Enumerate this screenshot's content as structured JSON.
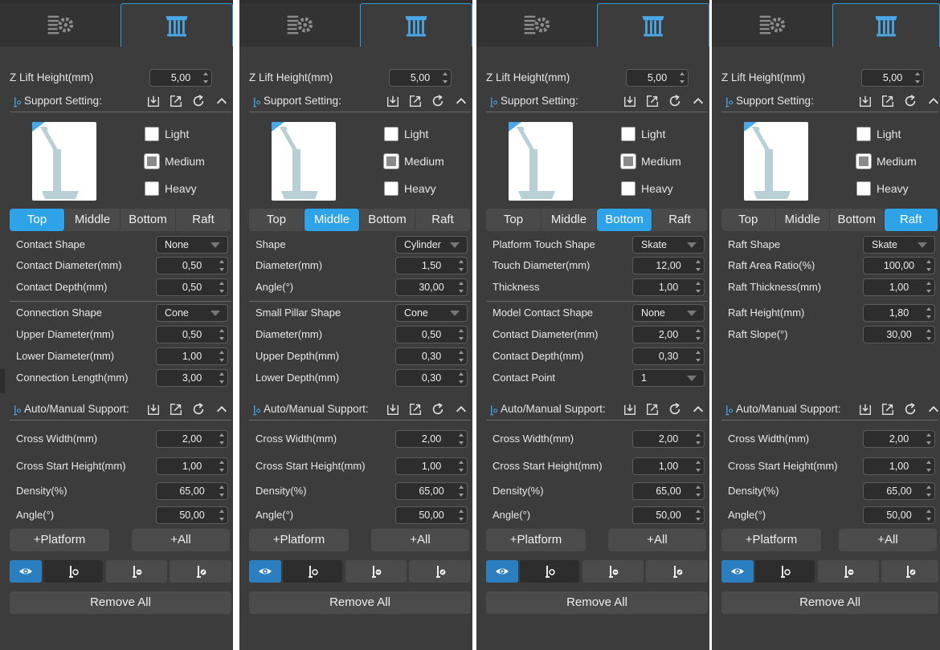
{
  "labels": {
    "z_lift": "Z Lift Height(mm)",
    "z_lift_value": "5,00",
    "support_setting": "Support Setting:",
    "auto_manual": "Auto/Manual Support:",
    "light": "Light",
    "medium": "Medium",
    "heavy": "Heavy",
    "tabs": [
      "Top",
      "Middle",
      "Bottom",
      "Raft"
    ],
    "platform": "+Platform",
    "all": "+All",
    "remove_all": "Remove All"
  },
  "auto": [
    {
      "label": "Cross Width(mm)",
      "value": "2,00"
    },
    {
      "label": "Cross Start Height(mm)",
      "value": "1,00"
    },
    {
      "label": "Density(%)",
      "value": "65,00"
    },
    {
      "label": "Angle(°)",
      "value": "50,00"
    }
  ],
  "panels": [
    {
      "active_tab": "Top",
      "rows": [
        {
          "label": "Contact Shape",
          "value": "None",
          "kind": "combo"
        },
        {
          "label": "Contact Diameter(mm)",
          "value": "0,50",
          "kind": "spin"
        },
        {
          "label": "Contact Depth(mm)",
          "value": "0,50",
          "kind": "spin"
        },
        {
          "label": "Connection Shape",
          "value": "Cone",
          "kind": "combo"
        },
        {
          "label": "Upper Diameter(mm)",
          "value": "0,50",
          "kind": "spin"
        },
        {
          "label": "Lower Diameter(mm)",
          "value": "1,00",
          "kind": "spin"
        },
        {
          "label": "Connection Length(mm)",
          "value": "3,00",
          "kind": "spin"
        }
      ]
    },
    {
      "active_tab": "Middle",
      "rows": [
        {
          "label": "Shape",
          "value": "Cylinder",
          "kind": "combo"
        },
        {
          "label": "Diameter(mm)",
          "value": "1,50",
          "kind": "spin"
        },
        {
          "label": "Angle(°)",
          "value": "30,00",
          "kind": "spin"
        },
        {
          "label": "Small Pillar Shape",
          "value": "Cone",
          "kind": "combo"
        },
        {
          "label": "Diameter(mm)",
          "value": "0,50",
          "kind": "spin"
        },
        {
          "label": "Upper Depth(mm)",
          "value": "0,30",
          "kind": "spin"
        },
        {
          "label": "Lower Depth(mm)",
          "value": "0,30",
          "kind": "spin"
        }
      ]
    },
    {
      "active_tab": "Bottom",
      "rows": [
        {
          "label": "Platform Touch Shape",
          "value": "Skate",
          "kind": "combo"
        },
        {
          "label": "Touch Diameter(mm)",
          "value": "12,00",
          "kind": "spin"
        },
        {
          "label": "Thickness",
          "value": "1,00",
          "kind": "spin"
        },
        {
          "label": "Model Contact Shape",
          "value": "None",
          "kind": "combo"
        },
        {
          "label": "Contact Diameter(mm)",
          "value": "2,00",
          "kind": "spin"
        },
        {
          "label": "Contact Depth(mm)",
          "value": "0,30",
          "kind": "spin"
        },
        {
          "label": "Contact Point",
          "value": "1",
          "kind": "combo"
        }
      ]
    },
    {
      "active_tab": "Raft",
      "rows": [
        {
          "label": "Raft Shape",
          "value": "Skate",
          "kind": "combo"
        },
        {
          "label": "Raft Area Ratio(%)",
          "value": "100,00",
          "kind": "spin"
        },
        {
          "label": "Raft Thickness(mm)",
          "value": "1,00",
          "kind": "spin"
        },
        {
          "label": "Raft Height(mm)",
          "value": "1,80",
          "kind": "spin"
        },
        {
          "label": "Raft Slope(°)",
          "value": "30,00",
          "kind": "spin"
        }
      ]
    }
  ],
  "icons": {
    "tab1": "slice-settings-icon",
    "tab2": "support-settings-icon",
    "section": "support-pin-icon",
    "import": "import-icon",
    "export": "export-icon",
    "reset": "refresh-icon",
    "collapse": "chevron-up-icon",
    "visibility": "eye-icon",
    "add_support": "add-support-icon",
    "remove_support": "remove-support-icon",
    "edit_support": "edit-support-icon"
  },
  "colors": {
    "panel_bg": "#3c3c3c",
    "accent": "#2ea3e8",
    "input_bg": "#2d2d2d"
  }
}
